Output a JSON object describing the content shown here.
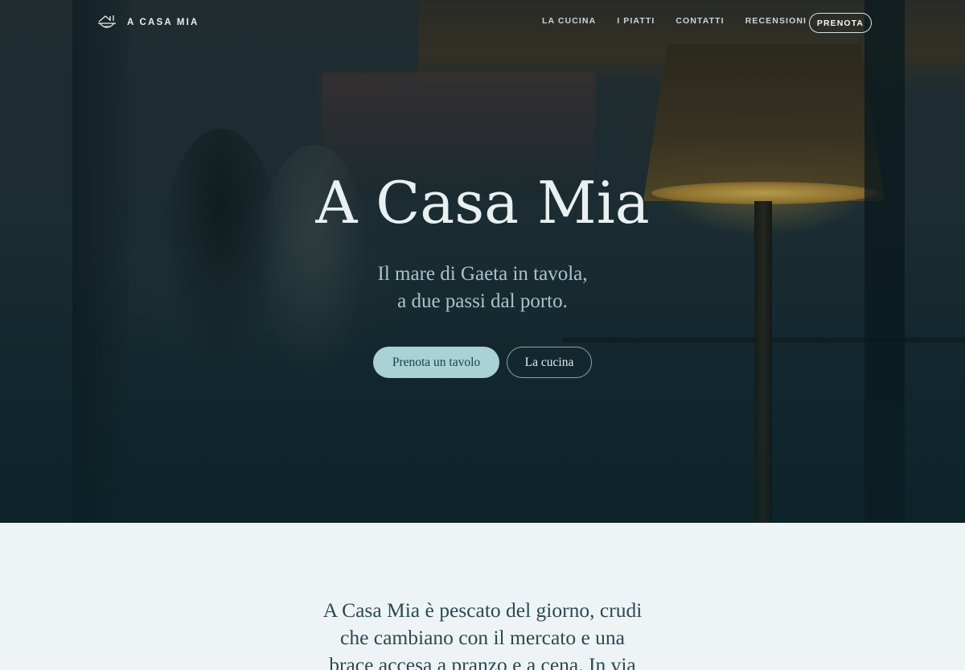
{
  "nav": {
    "brand_icon": "house-bowl-icon",
    "brand_name": "A CASA MIA",
    "links": [
      {
        "label": "LA CUCINA"
      },
      {
        "label": "I PIATTI"
      },
      {
        "label": "CONTATTI"
      },
      {
        "label": "RECENSIONI"
      }
    ],
    "cta_label": "PRENOTA"
  },
  "hero": {
    "title": "A Casa Mia",
    "subtitle_line1": "Il mare di Gaeta in tavola,",
    "subtitle_line2": "a due passi dal porto.",
    "primary_button": "Prenota un tavolo",
    "secondary_button": "La cucina"
  },
  "intro": {
    "line1": "A Casa Mia è pescato del giorno, crudi",
    "line2": "che cambiano con il mercato e una",
    "line3": "brace accesa a pranzo e a cena. In via"
  },
  "colors": {
    "hero_overlay": "#0f252b",
    "primary_button_bg": "#a9d1d6",
    "intro_bg": "#eef4f5",
    "intro_text": "#2b4a52"
  }
}
